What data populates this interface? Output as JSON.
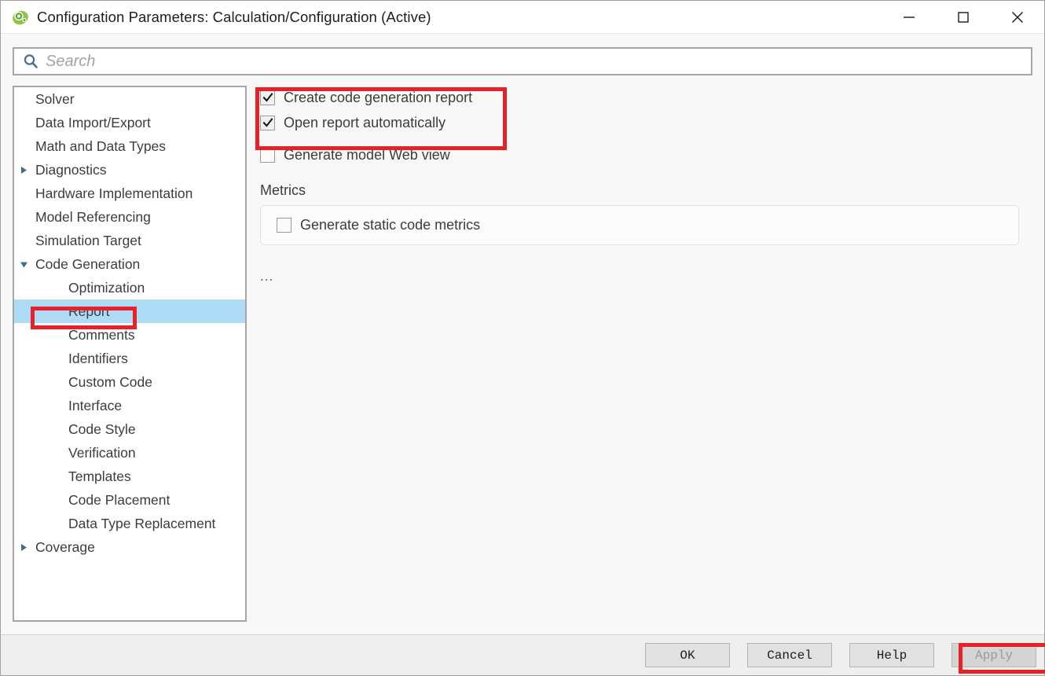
{
  "window": {
    "title": "Configuration Parameters: Calculation/Configuration (Active)",
    "icon": "simulink-config-icon",
    "controls": {
      "minimize": "minimize-icon",
      "maximize": "maximize-icon",
      "close": "close-icon"
    }
  },
  "search": {
    "placeholder": "Search",
    "value": "",
    "icon": "search-icon"
  },
  "tree": {
    "selected": "Report",
    "items": [
      {
        "label": "Solver",
        "level": 0,
        "arrow": "none",
        "selected": false
      },
      {
        "label": "Data Import/Export",
        "level": 0,
        "arrow": "none",
        "selected": false
      },
      {
        "label": "Math and Data Types",
        "level": 0,
        "arrow": "none",
        "selected": false
      },
      {
        "label": "Diagnostics",
        "level": 0,
        "arrow": "collapsed",
        "selected": false
      },
      {
        "label": "Hardware Implementation",
        "level": 0,
        "arrow": "none",
        "selected": false
      },
      {
        "label": "Model Referencing",
        "level": 0,
        "arrow": "none",
        "selected": false
      },
      {
        "label": "Simulation Target",
        "level": 0,
        "arrow": "none",
        "selected": false
      },
      {
        "label": "Code Generation",
        "level": 0,
        "arrow": "expanded",
        "selected": false
      },
      {
        "label": "Optimization",
        "level": 1,
        "arrow": "none",
        "selected": false
      },
      {
        "label": "Report",
        "level": 1,
        "arrow": "none",
        "selected": true
      },
      {
        "label": "Comments",
        "level": 1,
        "arrow": "none",
        "selected": false
      },
      {
        "label": "Identifiers",
        "level": 1,
        "arrow": "none",
        "selected": false
      },
      {
        "label": "Custom Code",
        "level": 1,
        "arrow": "none",
        "selected": false
      },
      {
        "label": "Interface",
        "level": 1,
        "arrow": "none",
        "selected": false
      },
      {
        "label": "Code Style",
        "level": 1,
        "arrow": "none",
        "selected": false
      },
      {
        "label": "Verification",
        "level": 1,
        "arrow": "none",
        "selected": false
      },
      {
        "label": "Templates",
        "level": 1,
        "arrow": "none",
        "selected": false
      },
      {
        "label": "Code Placement",
        "level": 1,
        "arrow": "none",
        "selected": false
      },
      {
        "label": "Data Type Replacement",
        "level": 1,
        "arrow": "none",
        "selected": false
      },
      {
        "label": "Coverage",
        "level": 0,
        "arrow": "collapsed",
        "selected": false
      }
    ]
  },
  "pane": {
    "checkboxes": [
      {
        "label": "Create code generation report",
        "checked": true
      },
      {
        "label": "Open report automatically",
        "checked": true
      },
      {
        "label": "Generate model Web view",
        "checked": false
      }
    ],
    "metrics": {
      "section_label": "Metrics",
      "checkbox": {
        "label": "Generate static code metrics",
        "checked": false
      }
    },
    "more_indicator": "..."
  },
  "footer": {
    "buttons": [
      {
        "label": "OK",
        "disabled": false
      },
      {
        "label": "Cancel",
        "disabled": false
      },
      {
        "label": "Help",
        "disabled": false
      },
      {
        "label": "Apply",
        "disabled": true
      }
    ]
  },
  "annotations": {
    "color": "#e8202a",
    "boxes": [
      {
        "name": "report-checkboxes-highlight"
      },
      {
        "name": "report-tree-item-highlight"
      },
      {
        "name": "apply-button-highlight"
      }
    ]
  }
}
